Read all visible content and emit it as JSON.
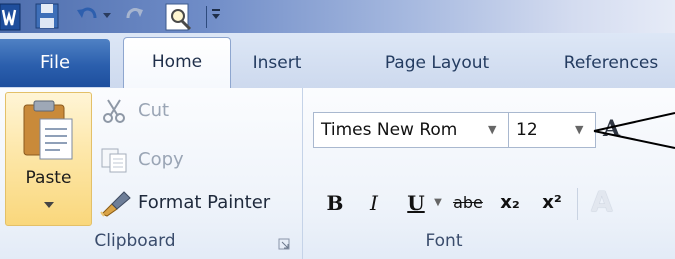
{
  "tabs": {
    "file": "File",
    "home": "Home",
    "insert": "Insert",
    "page_layout": "Page Layout",
    "references": "References"
  },
  "clipboard": {
    "paste": "Paste",
    "cut": "Cut",
    "copy": "Copy",
    "format_painter": "Format Painter",
    "group_label": "Clipboard"
  },
  "font": {
    "font_name": "Times New Rom",
    "font_size": "12",
    "bold": "B",
    "italic": "I",
    "underline": "U",
    "strikethrough": "abe",
    "subscript": "x₂",
    "superscript": "x²",
    "group_label": "Font"
  },
  "colors": {
    "file_tab": "#2b5fad",
    "paste_highlight": "#fde7a9",
    "ribbon_bg": "#eef3fa",
    "tab_text": "#243c61"
  },
  "icons": {
    "app": "word-logo-icon",
    "save": "save-icon",
    "undo": "undo-icon",
    "redo": "redo-icon",
    "print_preview": "print-preview-icon",
    "cut": "scissors-icon",
    "copy": "copy-icon",
    "format_painter": "paintbrush-icon",
    "paste": "clipboard-icon",
    "dialog_launcher": "dialog-launcher-icon",
    "text_effects": "text-effects-icon"
  }
}
